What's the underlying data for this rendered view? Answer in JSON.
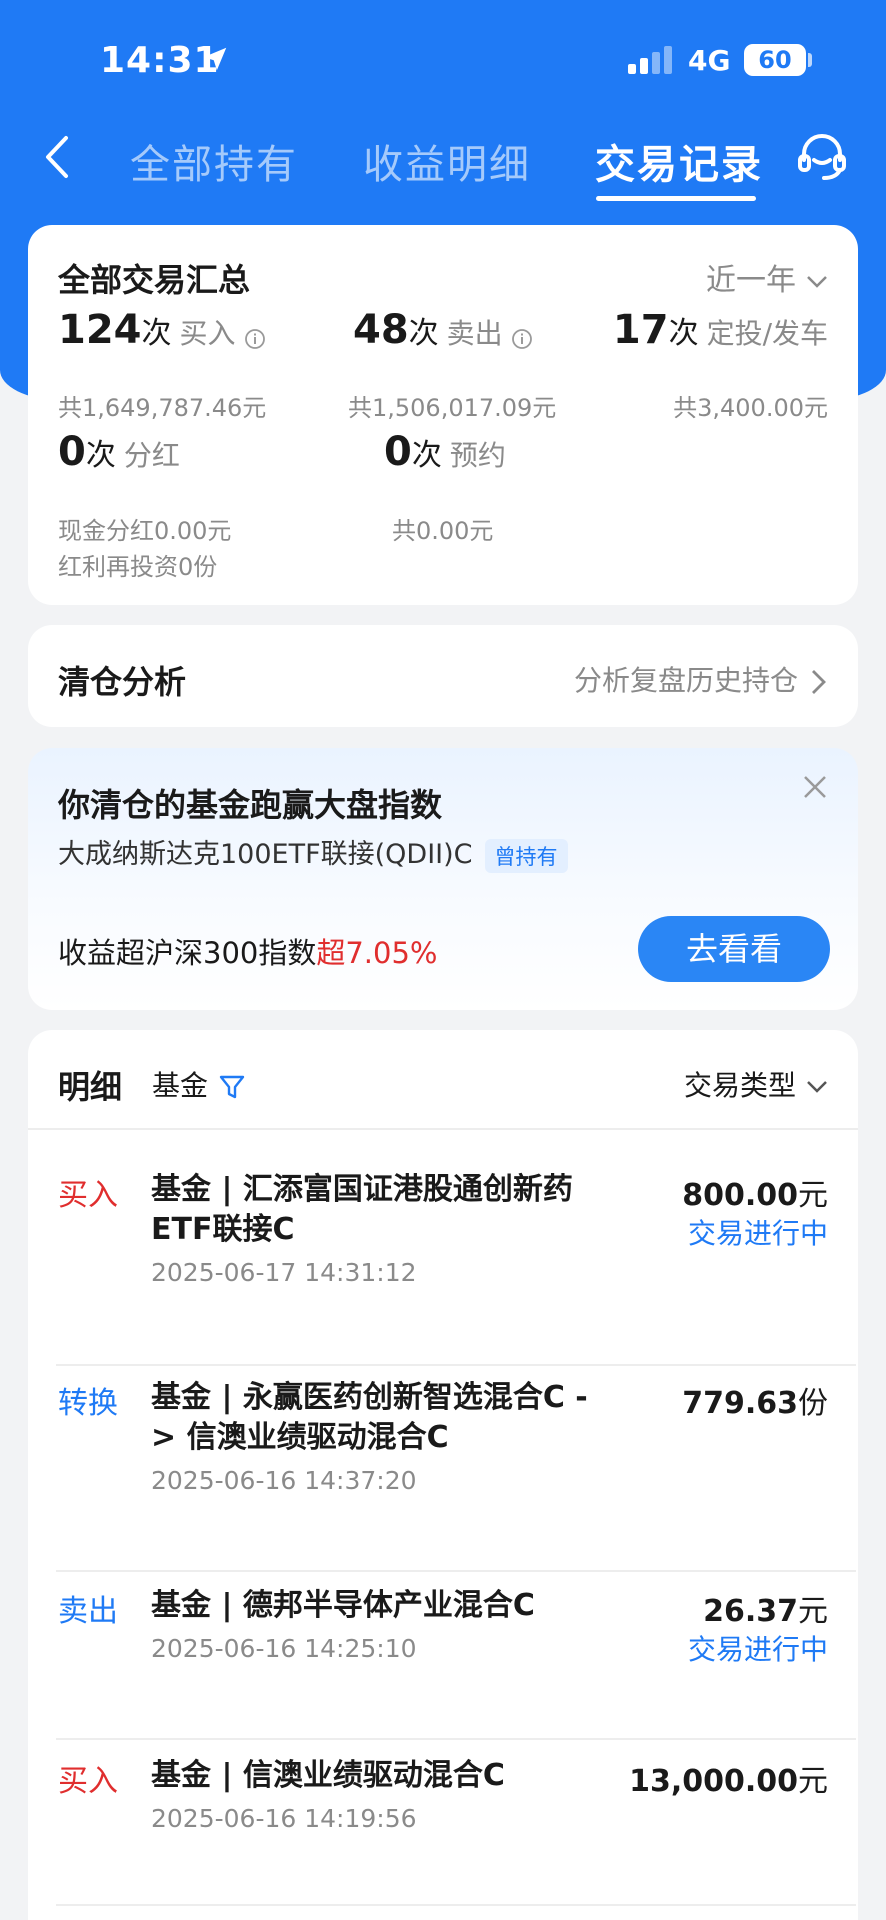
{
  "status_bar": {
    "time": "14:31",
    "network": "4G",
    "battery": "60"
  },
  "nav": {
    "tabs": [
      {
        "label": "全部持有"
      },
      {
        "label": "收益明细"
      },
      {
        "label": "交易记录"
      }
    ],
    "active_tab": "交易记录"
  },
  "summary": {
    "title": "全部交易汇总",
    "period": "近一年",
    "buy": {
      "count": "124",
      "unit": "次",
      "label": "买入",
      "total": "共1,649,787.46元"
    },
    "sell": {
      "count": "48",
      "unit": "次",
      "label": "卖出",
      "total": "共1,506,017.09元"
    },
    "auto": {
      "count": "17",
      "unit": "次",
      "label": "定投/发车",
      "total": "共3,400.00元"
    },
    "dividend": {
      "count": "0",
      "unit": "次",
      "label": "分红",
      "cash": "现金分红0.00元",
      "reinvest": "红利再投资0份"
    },
    "reserve": {
      "count": "0",
      "unit": "次",
      "label": "预约",
      "total": "共0.00元"
    }
  },
  "clear_analysis": {
    "title": "清仓分析",
    "link": "分析复盘历史持仓"
  },
  "promo": {
    "title": "你清仓的基金跑赢大盘指数",
    "fund": "大成纳斯达克100ETF联接(QDII)C",
    "tag": "曾持有",
    "text": "收益超沪深300指数",
    "highlight": "超7.05%",
    "button": "去看看"
  },
  "detail": {
    "title": "明细",
    "filter": "基金",
    "trade_type": "交易类型",
    "rows": [
      {
        "type": "买入",
        "name": "基金 | 汇添富国证港股通创新药ETF联接C",
        "date": "2025-06-17 14:31:12",
        "amount": "800.00",
        "unit": "元",
        "status": "交易进行中"
      },
      {
        "type": "转换",
        "name": "基金 | 永赢医药创新智选混合C -> 信澳业绩驱动混合C",
        "date": "2025-06-16 14:37:20",
        "amount": "779.63",
        "unit": "份",
        "status": ""
      },
      {
        "type": "卖出",
        "name": "基金 | 德邦半导体产业混合C",
        "date": "2025-06-16 14:25:10",
        "amount": "26.37",
        "unit": "元",
        "status": "交易进行中"
      },
      {
        "type": "买入",
        "name": "基金 | 信澳业绩驱动混合C",
        "date": "2025-06-16 14:19:56",
        "amount": "13,000.00",
        "unit": "元",
        "status": ""
      }
    ]
  },
  "colors": {
    "brand_blue": "#1f7af5",
    "buy_red": "#e02e2e",
    "muted": "#8a8a8a"
  }
}
